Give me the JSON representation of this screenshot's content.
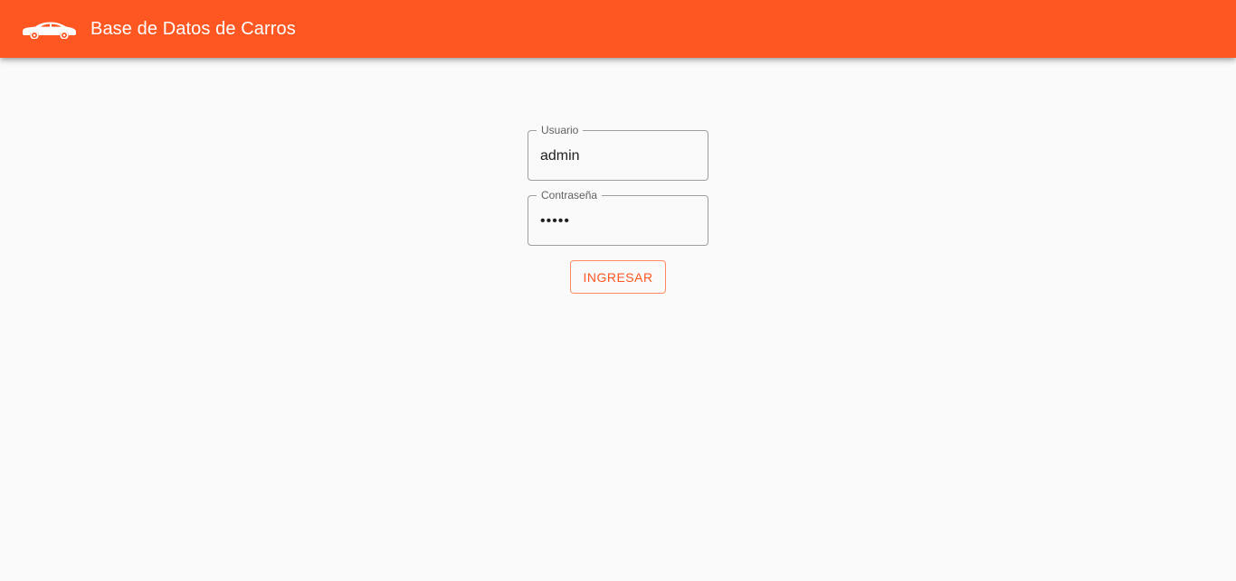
{
  "app_bar": {
    "icon": "car-icon",
    "title": "Base de Datos de Carros",
    "color": "#ff5722"
  },
  "login": {
    "username": {
      "label": "Usuario",
      "value": "admin"
    },
    "password": {
      "label": "Contraseña",
      "value": "admin"
    },
    "submit_label": "INGRESAR"
  }
}
